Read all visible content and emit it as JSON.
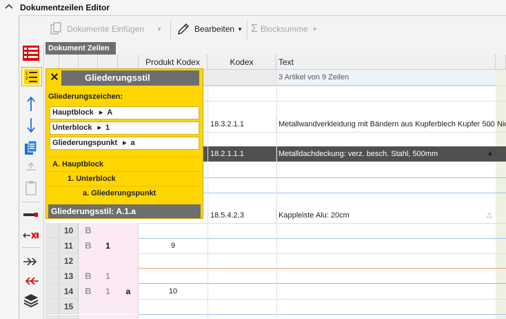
{
  "title": "Dokumentzeilen Editor",
  "toolbar": {
    "docs_insert": "Dokumente Einfügen",
    "edit": "Bearbeiten",
    "block_sum": "Blocksumme"
  },
  "panel_tab": "Dokument Zeilen",
  "grid": {
    "headers": {
      "product_code": "Produkt Kodex",
      "code": "Kodex",
      "text": "Text"
    },
    "summary": "3 Artikel von 9 Zeilen",
    "rows_top": [
      {
        "code": "18.3.2.1.1",
        "text": "Metallwandverkleidung mit Bändern aus Kupferblech Kupfer 500",
        "extra": "Nic"
      },
      {
        "code": "18.2.1.1.1",
        "text": "Metalldachdeckung: verz. besch. Stahl, 500mm",
        "extra": ""
      },
      {
        "code": "18.5.4.2.3",
        "text": "Kappleiste Alu: 20cm",
        "extra": ""
      }
    ],
    "rows": [
      {
        "num": "10",
        "c1": "B",
        "c2": "",
        "c3": "",
        "c4": ""
      },
      {
        "num": "11",
        "c1": "B",
        "c2": "1",
        "c3": "",
        "c4": "9"
      },
      {
        "num": "12",
        "c1": "",
        "c2": "",
        "c3": "",
        "c4": ""
      },
      {
        "num": "13",
        "c1": "B",
        "c2": "1",
        "c3": "",
        "c4": ""
      },
      {
        "num": "14",
        "c1": "B",
        "c2": "1",
        "c3": "a",
        "c4": "10"
      },
      {
        "num": "15",
        "c1": "",
        "c2": "",
        "c3": "",
        "c4": ""
      }
    ]
  },
  "popup": {
    "title": "Gliederungsstil",
    "section_label": "Gliederungszeichen:",
    "levels": [
      {
        "name": "Hauptblock",
        "value": "A"
      },
      {
        "name": "Unterblock",
        "value": "1"
      },
      {
        "name": "Gliederungspunkt",
        "value": "a"
      }
    ],
    "preview": [
      "A.  Hauptblock",
      "1.  Unterblock",
      "a.  Gliederungspunkt"
    ],
    "footer": "Gliederungsstil:  A.1.a"
  },
  "colors": {
    "accent_yellow": "#ffd600",
    "header_gray": "#6e6e6e",
    "pink": "#fbe9f3",
    "blue_line": "#9cc3ea",
    "orange_line": "#f0a36c",
    "selected_row": "#505050"
  }
}
